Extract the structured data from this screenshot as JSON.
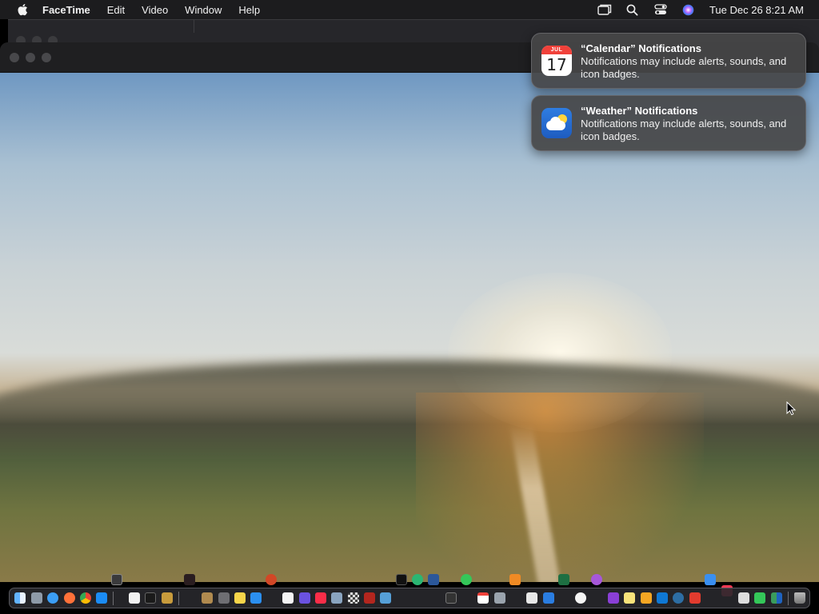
{
  "menubar": {
    "app_name": "FaceTime",
    "menus": [
      "Edit",
      "Video",
      "Window",
      "Help"
    ],
    "clock": "Tue Dec 26  8:21 AM",
    "status_icons": [
      "screen-mirroring-icon",
      "spotlight-search-icon",
      "control-center-icon",
      "siri-icon"
    ]
  },
  "notifications": [
    {
      "app": "Calendar",
      "title": "“Calendar” Notifications",
      "body": "Notifications may include alerts, sounds, and icon badges.",
      "icon": "calendar-icon",
      "icon_month": "JUL",
      "icon_day": "17"
    },
    {
      "app": "Weather",
      "title": "“Weather” Notifications",
      "body": "Notifications may include alerts, sounds, and icon badges.",
      "icon": "weather-icon"
    }
  ],
  "colors": {
    "menubar_bg": "#1c1c1e",
    "notification_bg": "#464648",
    "dock_bg": "#28282c",
    "calendar_red": "#f0413a",
    "weather_blue": "#2f7de1"
  },
  "dock": {
    "apps": [
      "finder",
      "launchpad",
      "safari",
      "firefox",
      "chrome",
      "app-store",
      "textedit",
      "terminal",
      "brush-app",
      "folder",
      "screenshot",
      "notes",
      "migration",
      "reminders",
      "shortcuts",
      "news",
      "preview",
      "acrobat",
      "xcode-helper",
      "voice-memos",
      "calendar",
      "system-monitor",
      "books-reader",
      "keynote",
      "clock",
      "podcasts-purple",
      "stickies",
      "pages",
      "outlook",
      "safari-2",
      "scrobbler",
      "photos",
      "facetime",
      "finder-2",
      "trash"
    ],
    "shelf_apps": [
      "chip-monitor",
      "dark-app",
      "powerpoint",
      "apple-tv",
      "maps",
      "word",
      "messages",
      "books",
      "excel",
      "podcasts",
      "mail",
      "music"
    ]
  }
}
